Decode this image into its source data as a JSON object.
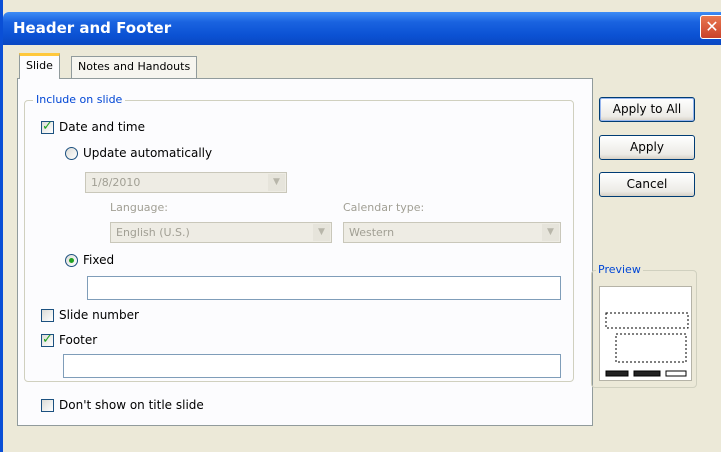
{
  "window": {
    "title": "Header and Footer",
    "close_glyph": "✕"
  },
  "tabs": [
    {
      "label": "Slide",
      "active": true
    },
    {
      "label": "Notes and Handouts",
      "active": false
    }
  ],
  "group": {
    "label": "Include on slide"
  },
  "date_time": {
    "label": "Date and time",
    "checked": true,
    "update_auto_label": "Update automatically",
    "update_auto_selected": false,
    "date_value": "1/8/2010",
    "language_label": "Language:",
    "language_value": "English (U.S.)",
    "calendar_label": "Calendar type:",
    "calendar_value": "Western",
    "fixed_label": "Fixed",
    "fixed_selected": true,
    "fixed_value": ""
  },
  "slide_number": {
    "label": "Slide number",
    "checked": false
  },
  "footer": {
    "label": "Footer",
    "checked": true,
    "value": ""
  },
  "dont_show_title": {
    "label": "Don't show on title slide",
    "checked": false
  },
  "buttons": {
    "apply_all": "Apply to All",
    "apply": "Apply",
    "cancel": "Cancel"
  },
  "preview": {
    "label": "Preview"
  },
  "icons": {
    "close": "close-icon",
    "dropdown": "chevron-down-icon"
  },
  "colors": {
    "titlebar": "#0b52d4",
    "group_label": "#0046d5",
    "check": "#21a121",
    "active_tab_accent": "#ffc83c"
  }
}
